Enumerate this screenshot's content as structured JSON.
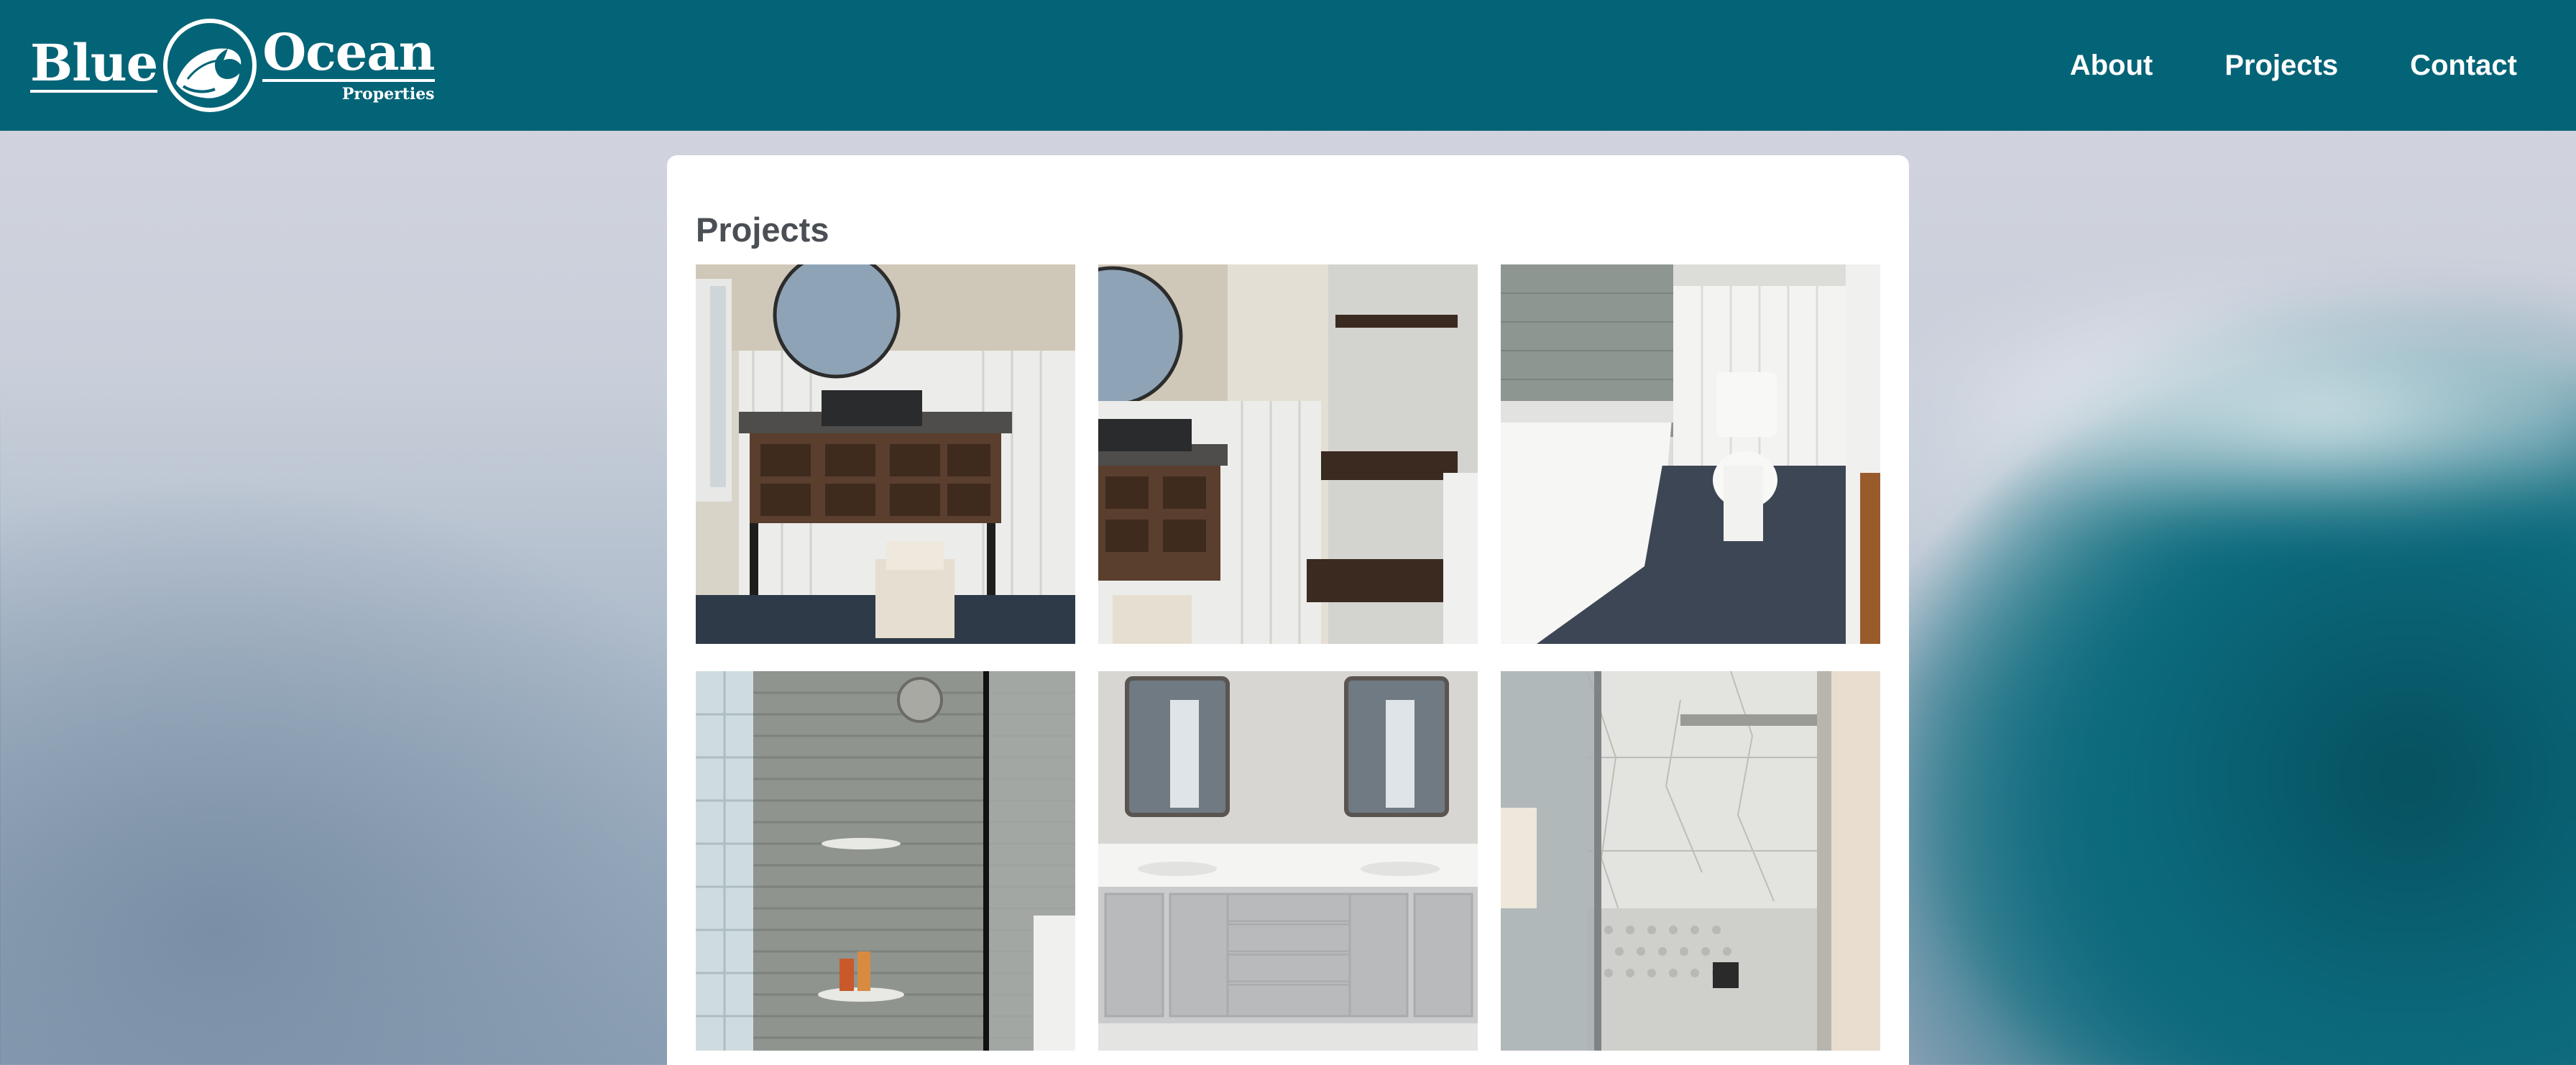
{
  "brand": {
    "name_left": "Blue",
    "name_right": "Ocean",
    "tagline": "Properties",
    "emblem_icon": "wave-emblem-icon"
  },
  "nav": {
    "items": [
      {
        "label": "About"
      },
      {
        "label": "Projects"
      },
      {
        "label": "Contact"
      }
    ]
  },
  "page": {
    "title": "Projects"
  },
  "projects": [
    {
      "subject": "bathroom vanity with round mirror"
    },
    {
      "subject": "vanity with built-in shelving"
    },
    {
      "subject": "bathtub and toilet"
    },
    {
      "subject": "subway tile walk-in shower"
    },
    {
      "subject": "double vanity with two mirrors"
    },
    {
      "subject": "marble shower with glass door"
    }
  ],
  "colors": {
    "header": "#046477",
    "card": "#ffffff",
    "title": "#4a4f55"
  }
}
